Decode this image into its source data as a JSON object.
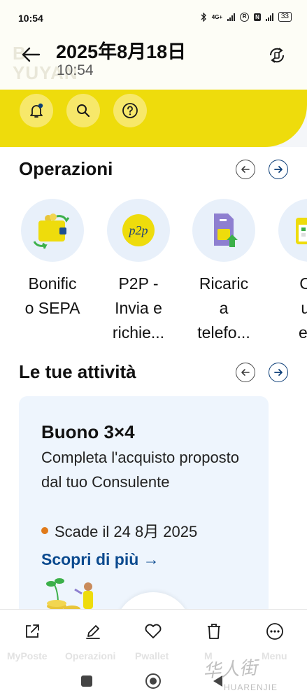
{
  "status_bar": {
    "time": "10:54",
    "network": "4G+",
    "battery": "33"
  },
  "header": {
    "title": "2025年8月18日",
    "subtitle": "10:54",
    "background_text_1": "B",
    "background_text_2": "YUYAN"
  },
  "quick_actions": [
    "notifications-icon",
    "search-icon",
    "help-icon"
  ],
  "operations": {
    "title": "Operazioni",
    "items": [
      {
        "label_lines": [
          "Bonific",
          "o SEPA"
        ],
        "icon": "wallet-transfer-icon"
      },
      {
        "label_lines": [
          "P2P -",
          "Invia e",
          "richie..."
        ],
        "icon": "p2p-icon"
      },
      {
        "label_lines": [
          "Ricaric",
          "a",
          "telefo..."
        ],
        "icon": "sim-card-icon"
      },
      {
        "label_lines": [
          "Ce",
          "uff",
          "e p"
        ],
        "icon": "calendar-icon"
      }
    ]
  },
  "activities": {
    "title": "Le tue attività",
    "card": {
      "title": "Buono 3×4",
      "description": "Completa l'acquisto proposto dal tuo Consulente",
      "expiry": "Scade il 24 8月 2025",
      "link": "Scopri di più →"
    }
  },
  "toolbar": {
    "buttons": [
      "share-icon",
      "edit-icon",
      "heart-icon",
      "trash-icon",
      "more-icon"
    ],
    "ghost_labels": [
      "MyPoste",
      "Operazioni",
      "Pwallet",
      "M",
      "Menu"
    ]
  },
  "watermark": {
    "text": "华人街",
    "sub": "HUARENJIE"
  },
  "colors": {
    "brand_yellow": "#eedc0c",
    "link_blue": "#0b4a8f",
    "accent_orange": "#e07a1a",
    "card_bg": "#eef5fd"
  }
}
